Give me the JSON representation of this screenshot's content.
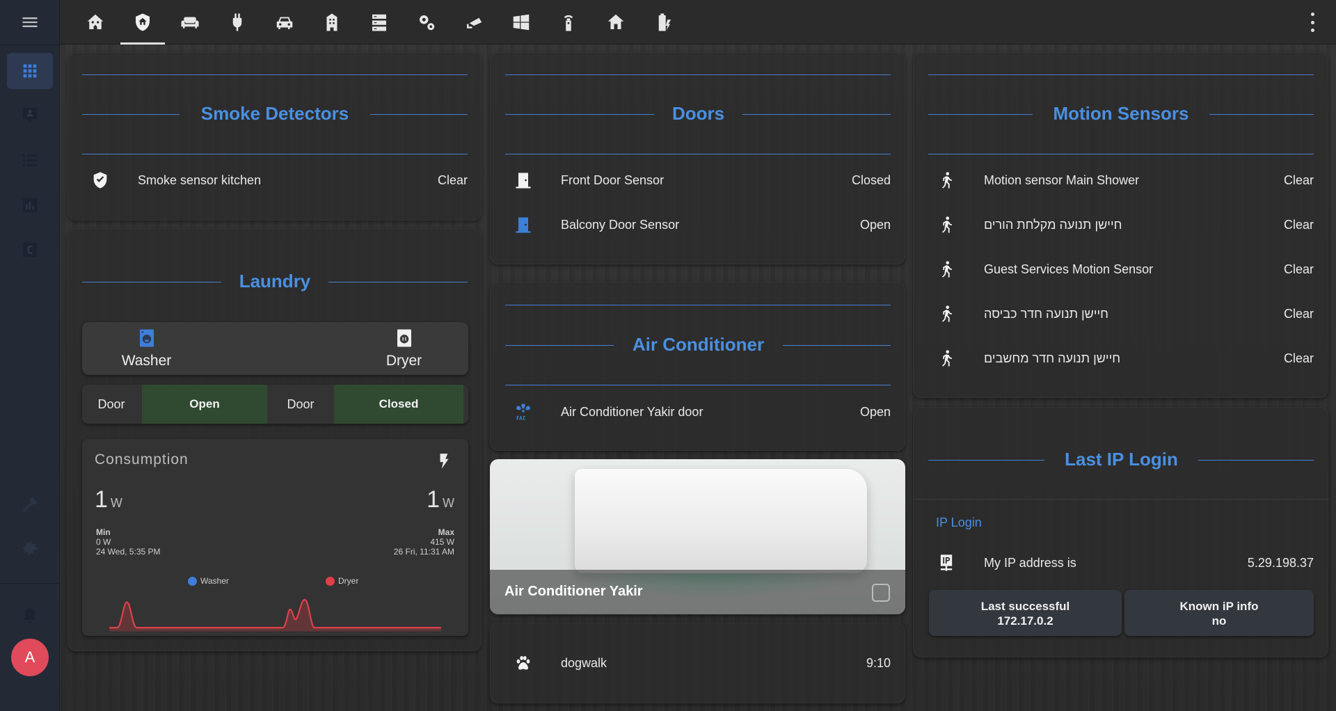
{
  "sidebar": {
    "menu_icon": "menu-icon",
    "items": [
      {
        "icon": "grid-icon",
        "active": true
      },
      {
        "icon": "map-account-icon"
      },
      {
        "icon": "list-icon"
      },
      {
        "icon": "chart-icon"
      },
      {
        "icon": "c-box-icon"
      }
    ],
    "bottom_items": [
      {
        "icon": "hammer-icon"
      },
      {
        "icon": "gear-icon"
      },
      {
        "icon": "bell-icon"
      }
    ],
    "avatar_letter": "A"
  },
  "toolbar": {
    "tabs": [
      {
        "icon": "home-assistant-icon"
      },
      {
        "icon": "shield-home-icon",
        "active": true
      },
      {
        "icon": "sofa-icon"
      },
      {
        "icon": "power-plug-icon"
      },
      {
        "icon": "car-icon"
      },
      {
        "icon": "building-icon"
      },
      {
        "icon": "server-icon"
      },
      {
        "icon": "cogs-icon"
      },
      {
        "icon": "cctv-icon"
      },
      {
        "icon": "windows-icon"
      },
      {
        "icon": "remote-icon"
      },
      {
        "icon": "home-icon"
      },
      {
        "icon": "battery-charging-icon"
      }
    ],
    "more_icon": "dots-vertical-icon"
  },
  "smoke": {
    "title": "Smoke Detectors",
    "rows": [
      {
        "name": "Smoke sensor kitchen",
        "state": "Clear",
        "icon": "shield-check-icon"
      }
    ]
  },
  "laundry": {
    "title": "Laundry",
    "washer_label": "Washer",
    "dryer_label": "Dryer",
    "door1_label": "Door",
    "door1_state": "Open",
    "door2_label": "Door",
    "door2_state": "Closed",
    "consumption": {
      "title": "Consumption",
      "min_value": "1",
      "max_value": "1",
      "unit": "W",
      "min_label": "Min",
      "min_watts": "0 W",
      "min_time": "24 Wed, 5:35 PM",
      "max_label": "Max",
      "max_watts": "415 W",
      "max_time": "26 Fri, 11:31 AM",
      "legend_washer": "Washer",
      "legend_dryer": "Dryer",
      "washer_color": "#3d7fd9",
      "dryer_color": "#e0404a"
    }
  },
  "doors": {
    "title": "Doors",
    "rows": [
      {
        "name": "Front Door Sensor",
        "state": "Closed",
        "icon": "door-closed-icon"
      },
      {
        "name": "Balcony Door Sensor",
        "state": "Open",
        "icon": "door-open-icon"
      }
    ]
  },
  "ac": {
    "title": "Air Conditioner",
    "rows": [
      {
        "name": "Air Conditioner Yakir door",
        "state": "Open",
        "icon": "air-conditioner-icon"
      }
    ],
    "picture_title": "Air Conditioner Yakir"
  },
  "dogwalk": {
    "name": "dogwalk",
    "state": "9:10",
    "icon": "paw-icon"
  },
  "motion": {
    "title": "Motion Sensors",
    "rows": [
      {
        "name": "Motion sensor Main Shower",
        "state": "Clear"
      },
      {
        "name": "חיישן תנועה מקלחת הורים",
        "state": "Clear"
      },
      {
        "name": "Guest Services Motion Sensor",
        "state": "Clear"
      },
      {
        "name": "חיישן תנועה חדר כביסה",
        "state": "Clear"
      },
      {
        "name": "חיישן תנועה חדר מחשבים",
        "state": "Clear"
      }
    ]
  },
  "ip": {
    "title": "Last IP Login",
    "section_label": "IP Login",
    "row_name": "My IP address is",
    "row_value": "5.29.198.37",
    "btn1_title": "Last successful",
    "btn1_value": "172.17.0.2",
    "btn2_title": "Known iP info",
    "btn2_value": "no"
  },
  "colors": {
    "accent": "#4a90e2",
    "sidebar_bg": "#232a36",
    "active_icon": "#3d7fd9"
  }
}
